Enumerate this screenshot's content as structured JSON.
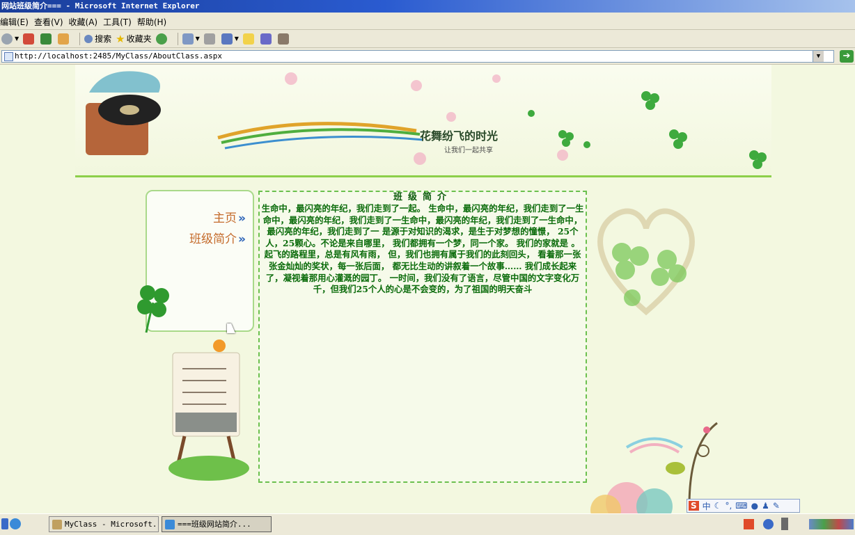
{
  "window": {
    "title": "网站班级简介=== - Microsoft Internet Explorer"
  },
  "menu": {
    "items": [
      "编辑(E)",
      "查看(V)",
      "收藏(A)",
      "工具(T)",
      "帮助(H)"
    ]
  },
  "toolbar": {
    "search_label": "搜索",
    "favorites_label": "收藏夹"
  },
  "address": {
    "url": "http://localhost:2485/MyClass/AboutClass.aspx"
  },
  "nav": {
    "items": [
      {
        "label": "主页",
        "arrow": "»"
      },
      {
        "label": "班级简介",
        "arrow": "»"
      }
    ]
  },
  "content": {
    "title": "班级简介",
    "body": "生命中，最闪亮的年纪，我们走到了一起。 生命中，最闪亮的年纪，我们走到了一生命中，最闪亮的年纪，我们走到了一生命中，最闪亮的年纪，我们走到了一生命中，最闪亮的年纪，我们走到了一 是源于对知识的渴求，是生于对梦想的憧憬，  25个人，25颗心。不论是来自哪里，  我们都拥有一个梦，同一个家。  我们的家就是 。  起飞的路程里，总是有风有雨，  但，我们也拥有属于我们的此刻回头，  看着那一张张金灿灿的奖状，每一张后面，  都无比生动的讲叙着一个故事…… 我们成长起来了，凝视着那用心灌溉的园丁。 一时间，我们没有了语言，尽管中国的文字变化万千，但我们25个人的心是不会变的，为了祖国的明天奋斗"
  },
  "banner": {
    "slogan": "花舞纷飞的时光",
    "subslogan": "让我们一起共享"
  },
  "taskbar": {
    "buttons": [
      {
        "label": "MyClass - Microsoft...",
        "active": false
      },
      {
        "label": "===班级网站简介...",
        "active": true
      }
    ]
  },
  "ime": {
    "label": "中"
  }
}
